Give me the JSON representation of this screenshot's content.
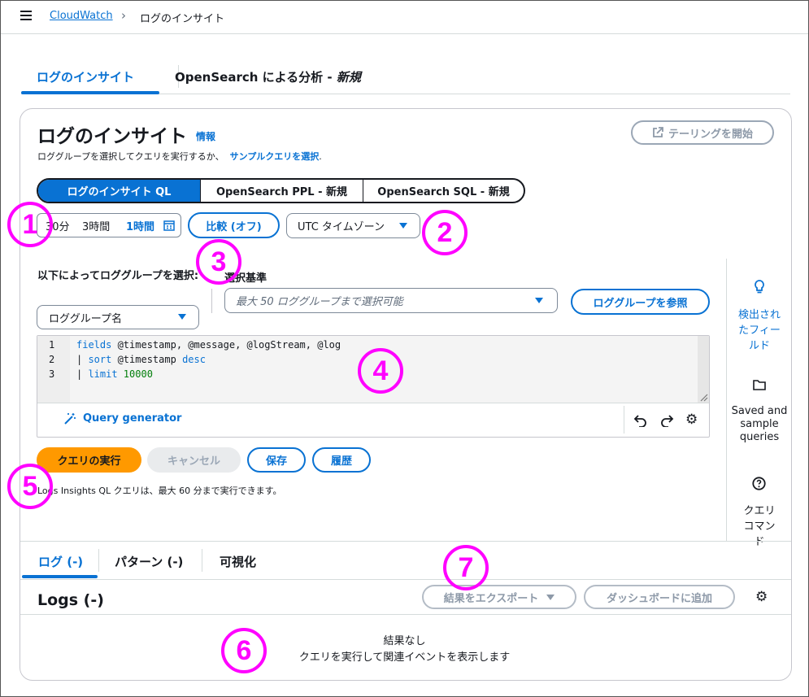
{
  "breadcrumb": {
    "service": "CloudWatch",
    "current": "ログのインサイト"
  },
  "page_tabs": [
    {
      "label": "ログのインサイト"
    },
    {
      "label": "OpenSearch による分析 - ",
      "new": "新規"
    }
  ],
  "header": {
    "title": "ログのインサイト",
    "info": "情報",
    "desc_prefix": "ロググループを選択してクエリを実行するか、",
    "desc_link": "サンプルクエリを選択",
    "desc_suffix": ".",
    "tail_button": "テーリングを開始"
  },
  "query_lang": [
    "ログのインサイト QL",
    "OpenSearch PPL - 新規",
    "OpenSearch SQL - 新規"
  ],
  "time": {
    "opt1": "30分",
    "opt2": "3時間",
    "opt3": "1時間"
  },
  "compare_button": "比較 (オフ)",
  "timezone": "UTC タイムゾーン",
  "select_by": {
    "label": "以下によってロググループを選択:",
    "value": "ロググループ名"
  },
  "criteria": {
    "label": "選択基準",
    "placeholder": "最大 50 ロググループまで選択可能"
  },
  "browse_button": "ロググループを参照",
  "code": {
    "line_numbers": [
      "1",
      "2",
      "3"
    ],
    "l1_kw": "fields",
    "l1_rest": " @timestamp, @message, @logStream, @log",
    "l2_pipe": "| ",
    "l2_kw": "sort",
    "l2_mid": " @timestamp ",
    "l2_kw2": "desc",
    "l3_pipe": "| ",
    "l3_kw": "limit",
    "l3_num": " 10000"
  },
  "query_generator": "Query generator",
  "actions": {
    "run": "クエリの実行",
    "cancel": "キャンセル",
    "save": "保存",
    "history": "履歴"
  },
  "note": "Logs Insights QL クエリは、最大 60 分まで実行できます。",
  "right_panel": {
    "discovered": "検出されたフィールド",
    "saved": "Saved and sample queries",
    "commands": "クエリコマンド"
  },
  "bottom_tabs": [
    "ログ (-)",
    "パターン (-)",
    "可視化"
  ],
  "logs": {
    "title": "Logs (-)",
    "export": "結果をエクスポート",
    "dashboard": "ダッシュボードに追加",
    "empty1": "結果なし",
    "empty2": "クエリを実行して関連イベントを表示します"
  },
  "annotations": [
    "1",
    "2",
    "3",
    "4",
    "5",
    "6",
    "7"
  ],
  "colors": {
    "accent": "#0972d3",
    "run": "#ff9900",
    "annotation": "#ff00ff"
  }
}
